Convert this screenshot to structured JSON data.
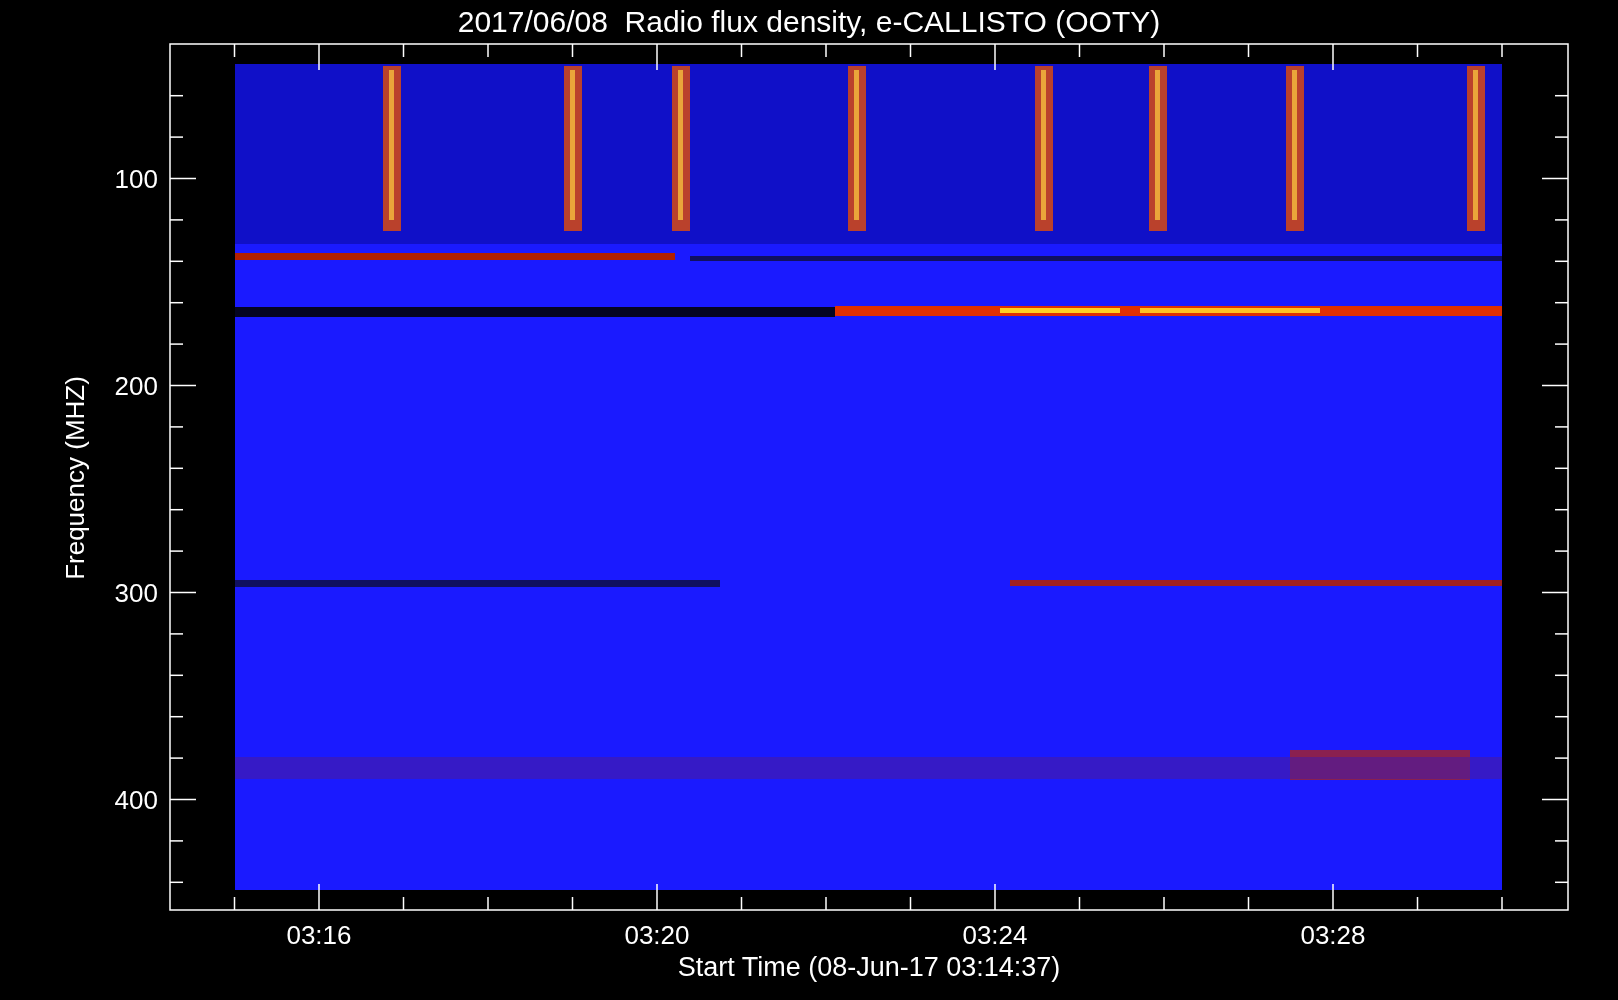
{
  "title": "2017/06/08  Radio flux density, e-CALLISTO (OOTY)",
  "ylabel": "Frequency (MHZ)",
  "xlabel": "Start Time (08-Jun-17 03:14:37)",
  "yticks": [
    "100",
    "200",
    "300",
    "400"
  ],
  "xticks": [
    "03:16",
    "03:20",
    "03:24",
    "03:28"
  ]
}
